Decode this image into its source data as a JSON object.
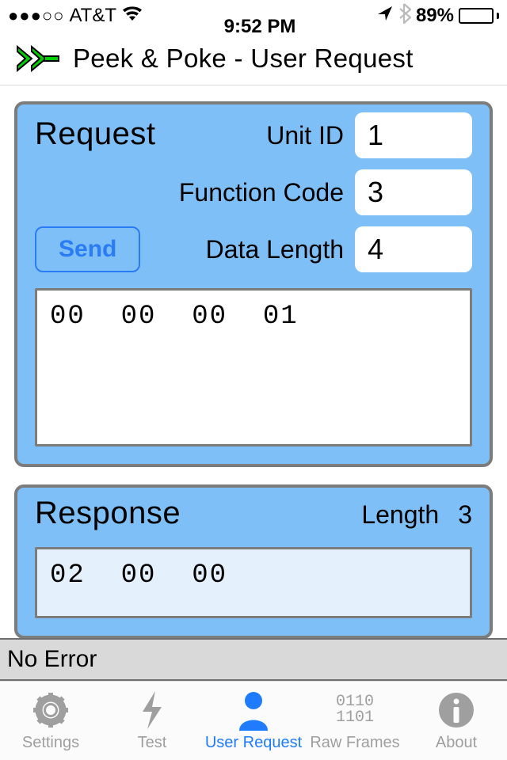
{
  "status": {
    "carrier_dots": "●●●○○",
    "carrier": "AT&T",
    "time": "9:52 PM",
    "battery_pct": "89%"
  },
  "nav": {
    "title": "Peek & Poke - User Request"
  },
  "request": {
    "title": "Request",
    "unit_id_label": "Unit ID",
    "unit_id_value": "1",
    "function_code_label": "Function Code",
    "function_code_value": "3",
    "data_length_label": "Data Length",
    "data_length_value": "4",
    "send_label": "Send",
    "hex": "00  00  00  01"
  },
  "response": {
    "title": "Response",
    "length_label": "Length",
    "length_value": "3",
    "hex": "02  00  00"
  },
  "error": {
    "text": "No Error"
  },
  "tabs": {
    "settings": "Settings",
    "test": "Test",
    "user_request": "User Request",
    "raw_frames": "Raw Frames",
    "raw_frames_icon_top": "0110",
    "raw_frames_icon_bottom": "1101",
    "about": "About"
  }
}
